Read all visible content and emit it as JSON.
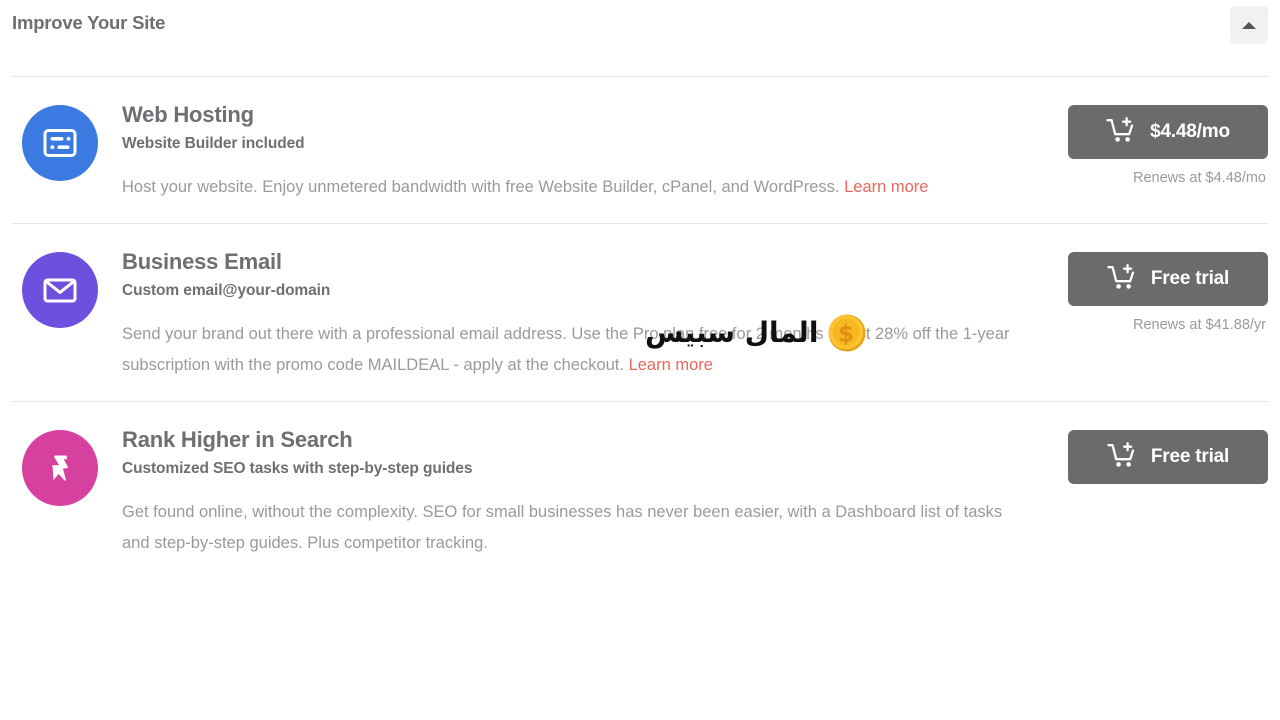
{
  "header": {
    "title": "Improve Your Site",
    "collapse_icon": "caret-up-icon"
  },
  "overlay": {
    "text": "المال سبيس",
    "icon": "coin-icon"
  },
  "colors": {
    "link": "#e8685d",
    "button": "#6b6b6b",
    "hosting_badge": "#3b7ae0",
    "email_badge": "#6e50df",
    "seo_badge": "#d6409f",
    "title_text": "#6e6e73",
    "body_text": "#9a9a9e",
    "divider": "#e7e7e8"
  },
  "products": [
    {
      "icon": "web-hosting-icon",
      "badge_color": "blue",
      "title": "Web Hosting",
      "subtitle": "Website Builder included",
      "description": "Host your website. Enjoy unmetered bandwidth with free Website Builder, cPanel, and WordPress. ",
      "link_label": "Learn more",
      "cta_icon": "add-to-cart-icon",
      "cta_label": "$4.48/mo",
      "renews": "Renews at $4.48/mo"
    },
    {
      "icon": "envelope-icon",
      "badge_color": "purple",
      "title": "Business Email",
      "subtitle": "Custom email@your-domain",
      "description": "Send your brand out there with a professional email address. Use the Pro plan free for 2 months or get 28% off the 1-year subscription with the promo code MAILDEAL - apply at the checkout. ",
      "link_label": "Learn more",
      "cta_icon": "add-to-cart-icon",
      "cta_label": "Free trial",
      "renews": "Renews at $41.88/yr"
    },
    {
      "icon": "lightning-bolt-icon",
      "badge_color": "pink",
      "title": "Rank Higher in Search",
      "subtitle": "Customized SEO tasks with step-by-step guides",
      "description": "Get found online, without the complexity. SEO for small businesses has never been easier, with a Dashboard list of tasks and step-by-step guides. Plus competitor tracking.",
      "link_label": "",
      "cta_icon": "add-to-cart-icon",
      "cta_label": "Free trial",
      "renews": ""
    }
  ]
}
